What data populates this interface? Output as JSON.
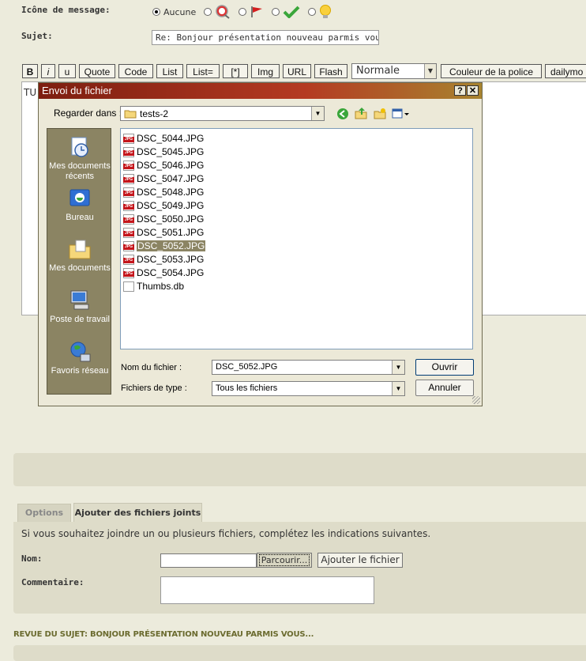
{
  "form": {
    "icon_label": "Icône de message:",
    "icon_none": "Aucune",
    "subject_label": "Sujet:",
    "subject_value": "Re: Bonjour présentation nouveau parmis vous..",
    "body_text": "TU"
  },
  "toolbar": {
    "buttons": [
      "B",
      "i",
      "u",
      "Quote",
      "Code",
      "List",
      "List=",
      "[*]",
      "Img",
      "URL",
      "Flash"
    ],
    "size_select": "Normale",
    "font_color": "Couleur de la police",
    "dailymotion": "dailymo"
  },
  "dialog": {
    "title": "Envoi du fichier",
    "look_in_label": "Regarder dans :",
    "look_in_value": "tests-2",
    "places": [
      "Mes documents récents",
      "Bureau",
      "Mes documents",
      "Poste de travail",
      "Favoris réseau"
    ],
    "files": [
      "DSC_5044.JPG",
      "DSC_5045.JPG",
      "DSC_5046.JPG",
      "DSC_5047.JPG",
      "DSC_5048.JPG",
      "DSC_5049.JPG",
      "DSC_5050.JPG",
      "DSC_5051.JPG",
      "DSC_5052.JPG",
      "DSC_5053.JPG",
      "DSC_5054.JPG",
      "Thumbs.db"
    ],
    "selected_file": "DSC_5052.JPG",
    "filename_label": "Nom du fichier :",
    "filename_value": "DSC_5052.JPG",
    "filetype_label": "Fichiers de type :",
    "filetype_value": "Tous les fichiers",
    "open_button": "Ouvrir",
    "cancel_button": "Annuler"
  },
  "attach": {
    "tab_options": "Options",
    "tab_attach": "Ajouter des fichiers joints",
    "intro": "Si vous souhaitez joindre un ou plusieurs fichiers, complétez les indications suivantes.",
    "name_label": "Nom:",
    "browse_button": "Parcourir...",
    "add_button": "Ajouter le fichier",
    "comment_label": "Commentaire:"
  },
  "review": {
    "title": "REVUE DU SUJET: BONJOUR PRÉSENTATION NOUVEAU PARMIS VOUS..."
  },
  "colors": {
    "page_bg": "#ecebdc",
    "panel_bg": "#dedcc9",
    "title_bar": "#7d1e10",
    "review_title": "#6b6b2f"
  }
}
